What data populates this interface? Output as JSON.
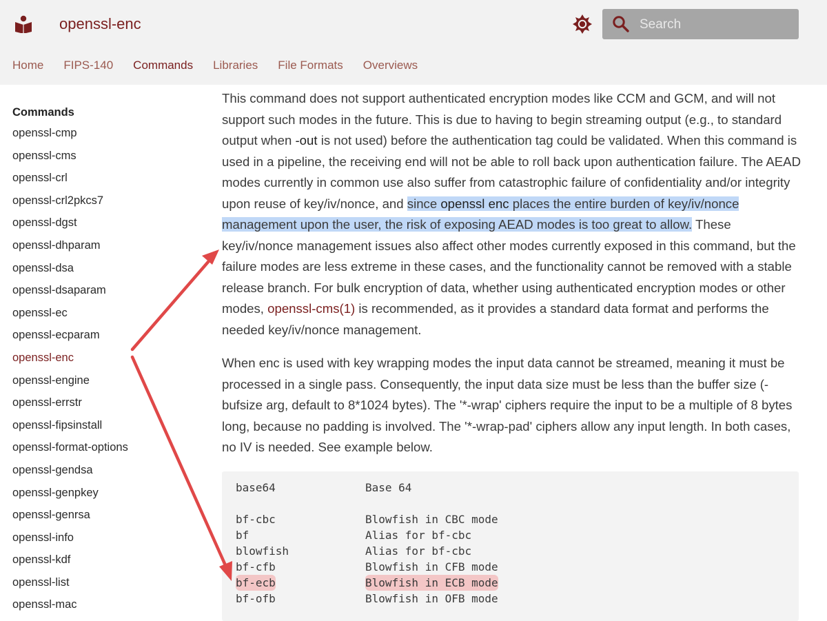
{
  "site": {
    "title": "openssl-enc"
  },
  "search": {
    "placeholder": "Search"
  },
  "nav": {
    "tabs": [
      "Home",
      "FIPS-140",
      "Commands",
      "Libraries",
      "File Formats",
      "Overviews"
    ],
    "active": "Commands"
  },
  "sidebar": {
    "heading": "Commands",
    "items": [
      "openssl-cmp",
      "openssl-cms",
      "openssl-crl",
      "openssl-crl2pkcs7",
      "openssl-dgst",
      "openssl-dhparam",
      "openssl-dsa",
      "openssl-dsaparam",
      "openssl-ec",
      "openssl-ecparam",
      "openssl-enc",
      "openssl-engine",
      "openssl-errstr",
      "openssl-fipsinstall",
      "openssl-format-options",
      "openssl-gendsa",
      "openssl-genpkey",
      "openssl-genrsa",
      "openssl-info",
      "openssl-kdf",
      "openssl-list",
      "openssl-mac"
    ],
    "active": "openssl-enc"
  },
  "content": {
    "p1": {
      "t1": "This command does not support authenticated encryption modes like CCM and GCM, and will not support such modes in the future. This is due to having to begin streaming output (e.g., to standard output when ",
      "code1": "-out",
      "t2": " is not used) before the authentication tag could be validated. When this command is used in a pipeline, the receiving end will not be able to roll back upon authentication failure. The AEAD modes currently in common use also suffer from catastrophic failure of confidentiality and/or integrity upon reuse of key/iv/nonce, and ",
      "hl1": "since ",
      "hl_code": "openssl enc",
      "hl2": " places the entire burden of key/iv/nonce management upon the user, the risk of exposing AEAD modes is too great to allow.",
      "t3": " These key/iv/nonce management issues also affect other modes currently exposed in this command, but the failure modes are less extreme in these cases, and the functionality cannot be removed with a stable release branch. For bulk encryption of data, whether using authenticated encryption modes or other modes, ",
      "link": "openssl-cms(1)",
      "t4": " is recommended, as it provides a standard data format and performs the needed key/iv/nonce management."
    },
    "p2": "When enc is used with key wrapping modes the input data cannot be streamed, meaning it must be processed in a single pass. Consequently, the input data size must be less than the buffer size (-bufsize arg, default to 8*1024 bytes). The '*-wrap' ciphers require the input to be a multiple of 8 bytes long, because no padding is involved. The '*-wrap-pad' ciphers allow any input length. In both cases, no IV is needed. See example below."
  },
  "code_block": {
    "rows": [
      {
        "name": "base64",
        "desc": "Base 64"
      },
      {
        "name": "bf-cbc",
        "desc": "Blowfish in CBC mode"
      },
      {
        "name": "bf",
        "desc": "Alias for bf-cbc"
      },
      {
        "name": "blowfish",
        "desc": "Alias for bf-cbc"
      },
      {
        "name": "bf-cfb",
        "desc": "Blowfish in CFB mode"
      },
      {
        "name": "bf-ecb",
        "desc": "Blowfish in ECB mode"
      },
      {
        "name": "bf-ofb",
        "desc": "Blowfish in OFB mode"
      }
    ]
  },
  "colors": {
    "brand": "#7a1f1f",
    "text_highlight": "#c0d8f7",
    "row_highlight": "#f3c6c6",
    "annotation_arrow": "#e04848"
  },
  "icons": {
    "logo": "book-reader-icon",
    "theme": "gear-sun-icon",
    "search": "search-icon"
  }
}
